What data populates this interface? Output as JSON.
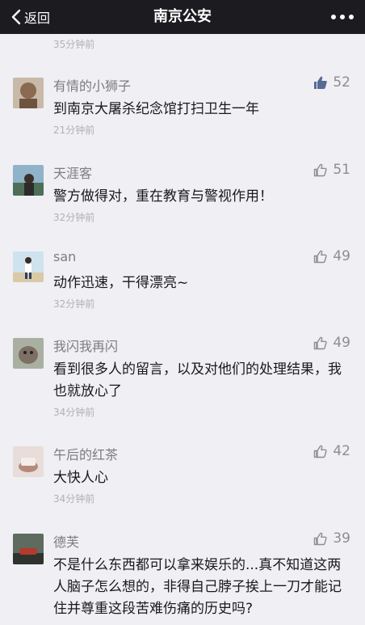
{
  "nav": {
    "back_label": "返回",
    "title": "南京公安"
  },
  "feed": {
    "previous_time": "35分钟前",
    "comments": [
      {
        "nickname": "有情的小狮子",
        "likes": "52",
        "liked": true,
        "content": "到南京大屠杀纪念馆打扫卫生一年",
        "time": "21分钟前"
      },
      {
        "nickname": "天涯客",
        "likes": "51",
        "liked": false,
        "content": "警方做得对，重在教育与警视作用！",
        "time": "32分钟前"
      },
      {
        "nickname": "san",
        "likes": "49",
        "liked": false,
        "content": "动作迅速，干得漂亮~",
        "time": "32分钟前"
      },
      {
        "nickname": "我闪我再闪",
        "likes": "49",
        "liked": false,
        "content": "看到很多人的留言，以及对他们的处理结果，我也就放心了",
        "time": "34分钟前"
      },
      {
        "nickname": "午后的红茶",
        "likes": "42",
        "liked": false,
        "content": "大快人心",
        "time": "34分钟前"
      },
      {
        "nickname": "德芙",
        "likes": "39",
        "liked": false,
        "content": "不是什么东西都可以拿来娱乐的...真不知道这两人脑子怎么想的，非得自己脖子挨上一刀才能记住并尊重这段苦难伤痛的历史吗?",
        "time": ""
      }
    ]
  },
  "colors": {
    "navbar": "#1c1c20",
    "background": "#efeff4",
    "like_active": "#576b95",
    "like_inactive": "#8e8e8e"
  }
}
